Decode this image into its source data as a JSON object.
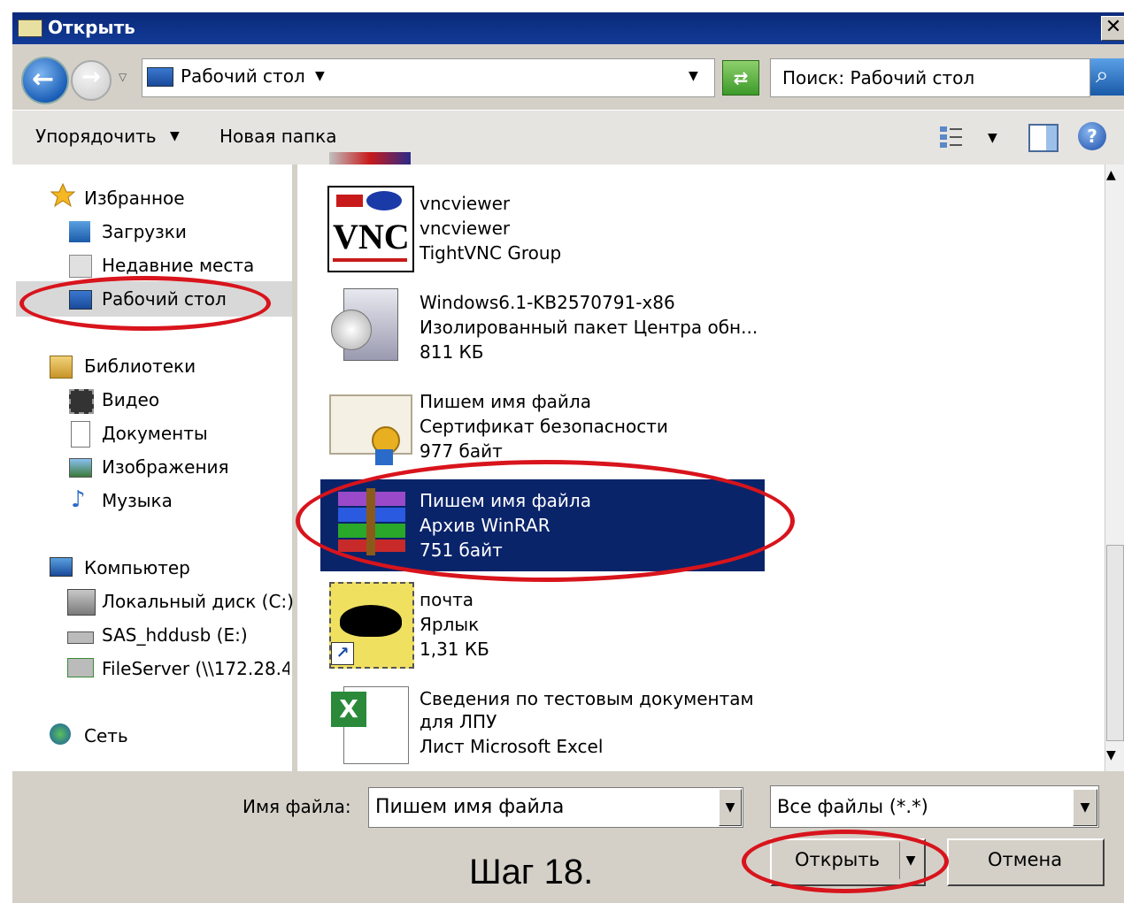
{
  "window": {
    "title": "Открыть",
    "close_glyph": "✕"
  },
  "address": {
    "location": "Рабочий стол",
    "search_placeholder": "Поиск: Рабочий стол"
  },
  "toolbar": {
    "organize_label": "Упорядочить",
    "new_folder_label": "Новая папка",
    "help_glyph": "?"
  },
  "nav": {
    "favorites": {
      "label": "Избранное",
      "items": [
        "Загрузки",
        "Недавние места",
        "Рабочий стол"
      ]
    },
    "libraries": {
      "label": "Библиотеки",
      "items": [
        "Видео",
        "Документы",
        "Изображения",
        "Музыка"
      ]
    },
    "computer": {
      "label": "Компьютер",
      "items": [
        "Локальный диск (C:)",
        "SAS_hddusb (E:)",
        "FileServer (\\\\172.28.4"
      ]
    },
    "network": {
      "label": "Сеть"
    },
    "selected": "Рабочий стол"
  },
  "files": [
    {
      "name": "vncviewer",
      "type": "vncviewer",
      "detail": "TightVNC Group",
      "icon": "vnc-icon"
    },
    {
      "name": "Windows6.1-KB2570791-x86",
      "type": "Изолированный пакет Центра обн...",
      "detail": "811 КБ",
      "icon": "msu-package-icon"
    },
    {
      "name": "Пишем имя файла",
      "type": "Сертификат безопасности",
      "detail": "977 байт",
      "icon": "certificate-icon"
    },
    {
      "name": "Пишем имя файла",
      "type": "Архив WinRAR",
      "detail": "751 байт",
      "icon": "winrar-archive-icon",
      "selected": true
    },
    {
      "name": "почта",
      "type": "Ярлык",
      "detail": "1,31 КБ",
      "icon": "thebat-shortcut-icon"
    },
    {
      "name": "Сведения по тестовым документам",
      "name_line2": "для ЛПУ",
      "type": "Лист Microsoft Excel",
      "icon": "excel-sheet-icon"
    }
  ],
  "bottom": {
    "filename_label": "Имя файла:",
    "filename_value": "Пишем имя файла",
    "filetype_value": "Все файлы (*.*)",
    "open_label": "Открыть",
    "cancel_label": "Отмена"
  },
  "caption": "Шаг 18.",
  "colors": {
    "titlebar": "#0a2a7a",
    "selection": "#0a246a",
    "annotation": "#d8141c",
    "dialog_bg": "#d4d0c8"
  }
}
